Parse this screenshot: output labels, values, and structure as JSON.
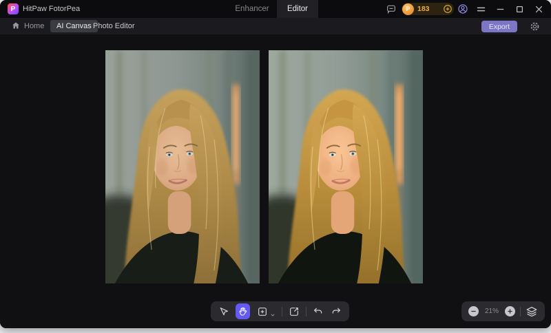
{
  "app": {
    "name": "HitPaw FotorPea"
  },
  "titlebar": {
    "tabs": [
      {
        "label": "Enhancer",
        "active": false
      },
      {
        "label": "Editor",
        "active": true
      }
    ],
    "credits": "183",
    "icons": [
      "feedback-icon",
      "coin-icon",
      "add-credits-icon",
      "account-icon",
      "menu-icon",
      "minimize-icon",
      "maximize-icon",
      "close-icon"
    ]
  },
  "navbar": {
    "home_label": "Home",
    "tabs": [
      {
        "label": "AI Canvas",
        "active": true
      },
      {
        "label": "Photo Editor",
        "active": false
      }
    ],
    "export_label": "Export",
    "icons": [
      "home-icon",
      "settings-gear-icon"
    ]
  },
  "canvas": {
    "images": [
      {
        "name": "portrait-before",
        "description": "blonde woman portrait, blurred wall, original"
      },
      {
        "name": "portrait-after",
        "description": "blonde woman portrait, blurred wall, enhanced"
      }
    ]
  },
  "tools": {
    "items": [
      "select-tool",
      "hand-tool",
      "add-element-tool",
      "replace-image-tool",
      "undo",
      "redo"
    ],
    "active_tool": "hand-tool"
  },
  "zoom": {
    "level": "21%"
  },
  "colors": {
    "accent": "#6459f2",
    "export_button": "#7c77c4",
    "credits_gold": "#e9b04a",
    "logo_pink": "#ff4d6d",
    "logo_purple": "#6a4dff",
    "titlebar_bg": "#0c0c0e",
    "navbar_bg": "#1b1b1f",
    "canvas_bg": "#101013",
    "pill_bg": "#2a2a2f"
  }
}
